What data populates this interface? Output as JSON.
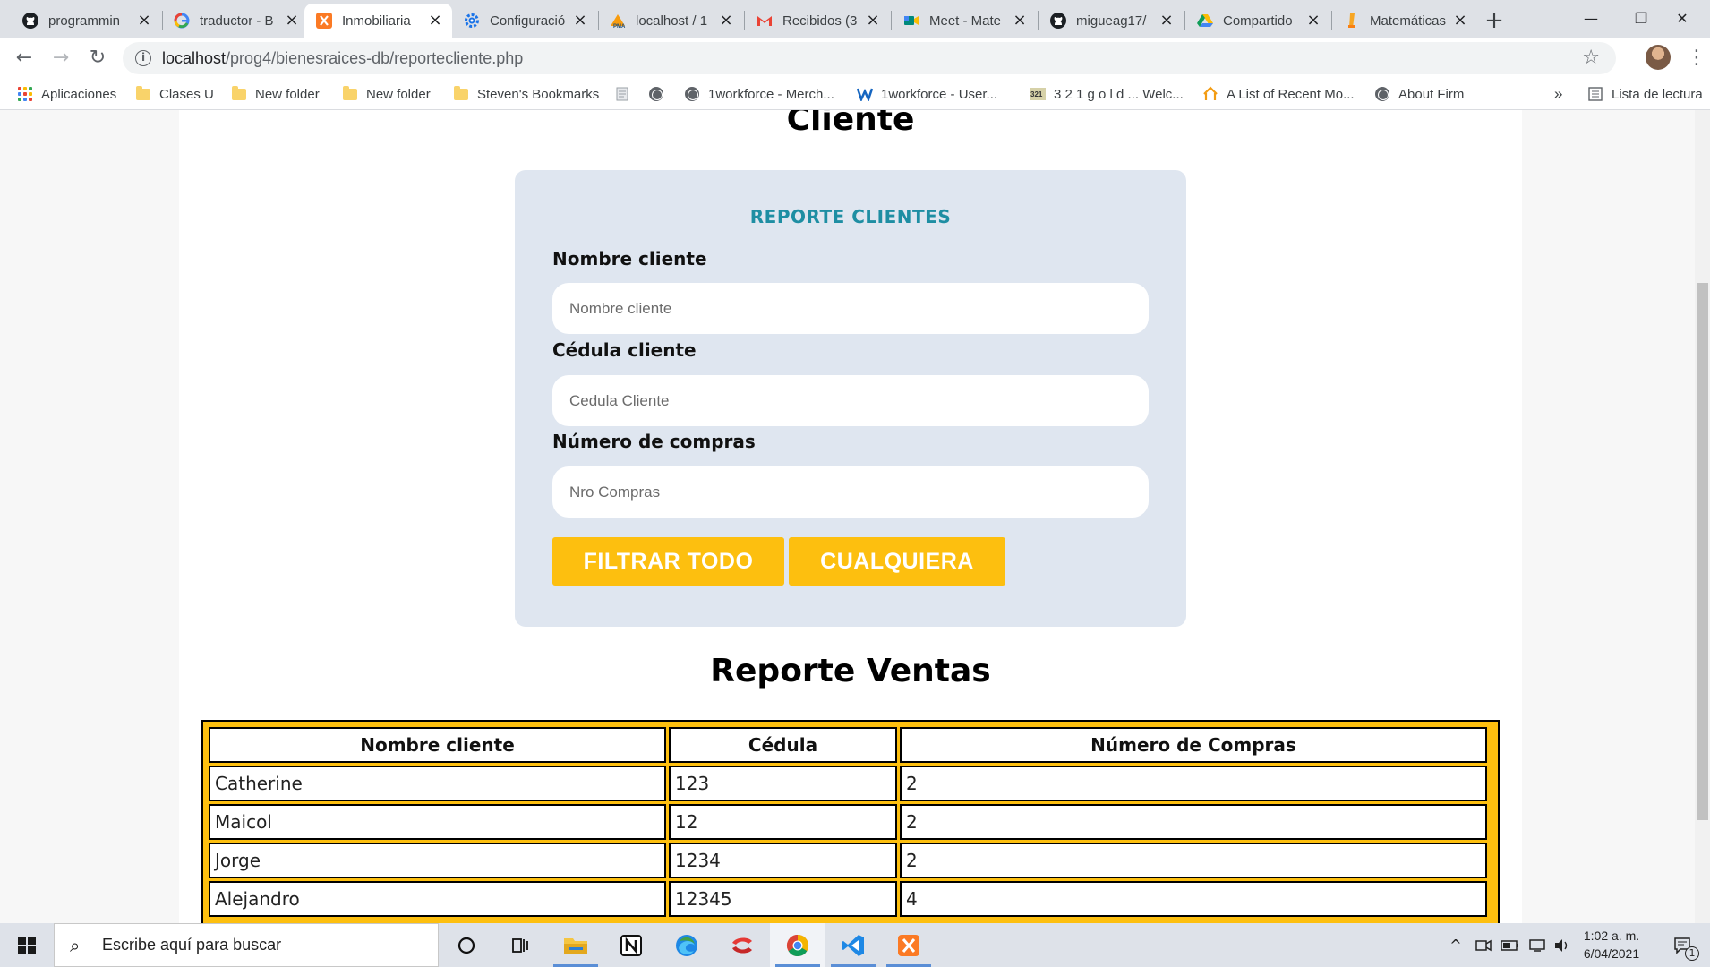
{
  "browser": {
    "tabs": [
      {
        "title": "programmin",
        "icon": "github-icon"
      },
      {
        "title": "traductor - B",
        "icon": "google-icon"
      },
      {
        "title": "Inmobiliaria",
        "icon": "xampp-icon",
        "active": true
      },
      {
        "title": "Configuració",
        "icon": "settings-icon"
      },
      {
        "title": "localhost / 1",
        "icon": "phpmyadmin-icon"
      },
      {
        "title": "Recibidos (3",
        "icon": "gmail-icon"
      },
      {
        "title": "Meet - Mate",
        "icon": "meet-icon"
      },
      {
        "title": "migueag17/",
        "icon": "github-icon"
      },
      {
        "title": "Compartido",
        "icon": "drive-icon"
      },
      {
        "title": "Matemáticas",
        "icon": "moodle-icon"
      }
    ],
    "new_tab": "+",
    "window_controls": {
      "minimize": "—",
      "restore": "❐",
      "close": "✕"
    },
    "url": {
      "host": "localhost",
      "path": "/prog4/bienesraices-db/reportecliente.php"
    },
    "bookmarks": [
      {
        "label": "Aplicaciones",
        "icon": "apps-icon"
      },
      {
        "label": "Clases U",
        "icon": "folder-icon"
      },
      {
        "label": "New folder",
        "icon": "folder-icon"
      },
      {
        "label": "New folder",
        "icon": "folder-icon"
      },
      {
        "label": "Steven's Bookmarks",
        "icon": "folder-icon"
      },
      {
        "label": "",
        "icon": "page-icon"
      },
      {
        "label": "",
        "icon": "globe-icon"
      },
      {
        "label": "1workforce - Merch...",
        "icon": "globe-icon"
      },
      {
        "label": "1workforce - User...",
        "icon": "workforce-icon"
      },
      {
        "label": "3 2 1 g o l d ... Welc...",
        "icon": "321-icon"
      },
      {
        "label": "A List of Recent Mo...",
        "icon": "house-icon"
      },
      {
        "label": "About Firm",
        "icon": "globe-icon"
      }
    ],
    "bookmarks_overflow": "»",
    "reading_list": "Lista de lectura"
  },
  "page": {
    "heading_top": "Cliente",
    "form": {
      "title": "REPORTE CLIENTES",
      "fields": [
        {
          "label": "Nombre cliente",
          "placeholder": "Nombre cliente",
          "value": ""
        },
        {
          "label": "Cédula cliente",
          "placeholder": "Cedula Cliente",
          "value": ""
        },
        {
          "label": "Número de compras",
          "placeholder": "Nro Compras",
          "value": ""
        }
      ],
      "buttons": {
        "filter_all": "FILTRAR TODO",
        "any": "CUALQUIERA"
      }
    },
    "report_heading": "Reporte Ventas",
    "table": {
      "headers": [
        "Nombre cliente",
        "Cédula",
        "Número de Compras"
      ],
      "rows": [
        [
          "Catherine",
          "123",
          "2"
        ],
        [
          "Maicol",
          "12",
          "2"
        ],
        [
          "Jorge",
          "1234",
          "2"
        ],
        [
          "Alejandro",
          "12345",
          "4"
        ]
      ]
    }
  },
  "taskbar": {
    "search_placeholder": "Escribe aquí para buscar",
    "apps": [
      "cortana-icon",
      "task-view-icon",
      "file-explorer-icon",
      "notion-icon",
      "edge-icon",
      "unknown-red-icon",
      "chrome-icon",
      "vscode-icon",
      "xampp-icon"
    ],
    "time": "1:02 a. m.",
    "date": "6/04/2021",
    "notification_count": "1"
  },
  "colors": {
    "accent_yellow": "#fdbf0f",
    "form_bg": "#dfe6f0",
    "form_title": "#1e8ea3"
  }
}
